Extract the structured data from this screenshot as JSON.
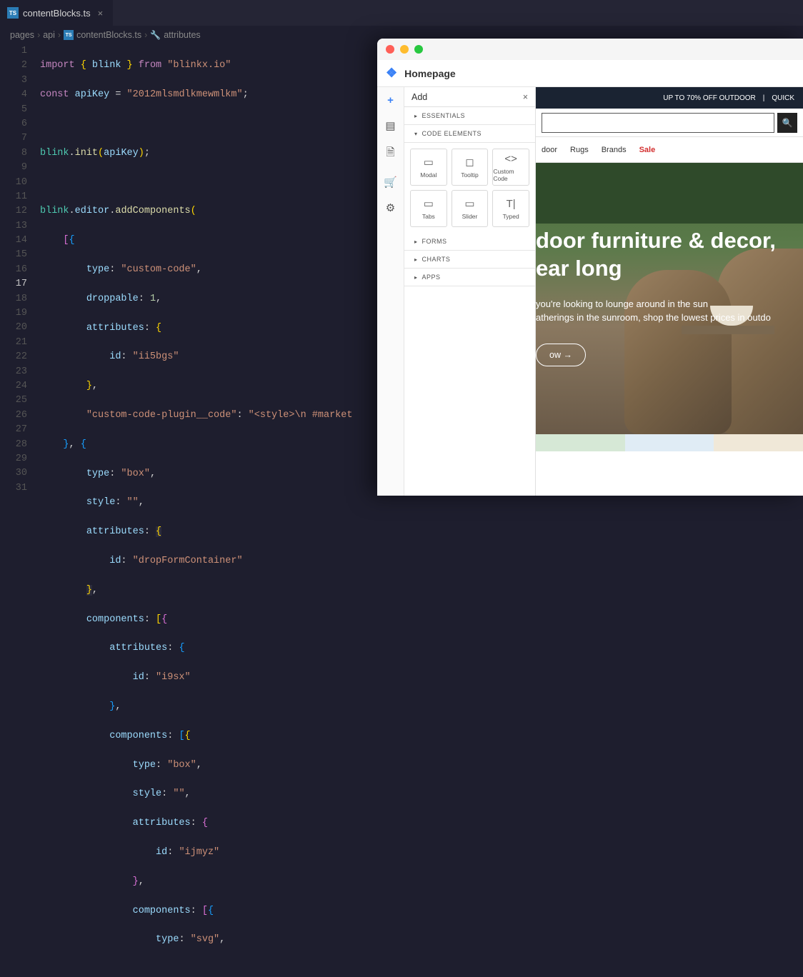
{
  "tab": {
    "filename": "contentBlocks.ts"
  },
  "breadcrumbs": {
    "seg1": "pages",
    "seg2": "api",
    "seg3": "contentBlocks.ts",
    "seg4": "attributes"
  },
  "code": {
    "l1_import": "import",
    "l1_brace_o": " { ",
    "l1_blink": "blink",
    "l1_brace_c": " } ",
    "l1_from": "from",
    "l1_str": " \"blinkx.io\"",
    "l2_const": "const",
    "l2_var": " apiKey",
    "l2_eq": " = ",
    "l2_str": "\"2012mlsmdlkmewmlkm\"",
    "l2_semi": ";",
    "l4_blink": "blink",
    "l4_dot1": ".",
    "l4_init": "init",
    "l4_p": "(apiKey);",
    "l6_blink": "blink",
    "l6_editor": ".editor.",
    "l6_add": "addComponents",
    "l6_open": "(",
    "l7": "    [{",
    "l8_type": "type",
    "l8_val": "\"custom-code\"",
    "l9_drop": "droppable",
    "l9_val": "1",
    "l10_attr": "attributes",
    "l11_id": "id",
    "l11_val": "\"ii5bgs\"",
    "l13_key": "\"custom-code-plugin__code\"",
    "l13_val": "\"<style>\\n #market",
    "l15_type": "type",
    "l15_val": "\"box\"",
    "l16_style": "style",
    "l16_val": "\"\"",
    "l17_attr": "attributes",
    "l18_id": "id",
    "l18_val": "\"dropFormContainer\"",
    "l20_comp": "components",
    "l21_attr": "attributes",
    "l22_id": "id",
    "l22_val": "\"i9sx\"",
    "l24_comp": "components",
    "l25_type": "type",
    "l25_val": "\"box\"",
    "l26_style": "style",
    "l26_val": "\"\"",
    "l27_attr": "attributes",
    "l28_id": "id",
    "l28_val": "\"ijmyz\"",
    "l30_comp": "components",
    "l31_type": "type",
    "l31_val": "\"svg\""
  },
  "line_numbers": [
    "1",
    "2",
    "3",
    "4",
    "5",
    "6",
    "7",
    "8",
    "9",
    "10",
    "11",
    "12",
    "13",
    "14",
    "15",
    "16",
    "17",
    "18",
    "19",
    "20",
    "21",
    "22",
    "23",
    "24",
    "25",
    "26",
    "27",
    "28",
    "29",
    "30",
    "31"
  ],
  "active_line": "17",
  "app": {
    "title": "Homepage",
    "add_label": "Add",
    "accordion": {
      "essentials": "ESSENTIALS",
      "code_elements": "CODE ELEMENTS",
      "forms": "FORMS",
      "charts": "CHARTS",
      "apps": "APPS"
    },
    "components": {
      "modal": "Modal",
      "tooltip": "Tooltip",
      "custom_code": "Custom Code",
      "tabs": "Tabs",
      "slider": "Slider",
      "typed": "Typed"
    },
    "promo": {
      "text": "UP TO 70% OFF OUTDOOR",
      "sep": "|",
      "quick": "QUICK"
    },
    "nav": {
      "cat1": "door",
      "cat2": "Rugs",
      "cat3": "Brands",
      "cat4": "Sale"
    },
    "hero": {
      "title1": "door furniture & decor,",
      "title2": "ear long",
      "sub1": "you're looking to lounge around in the sun",
      "sub2": "atherings in the sunroom, shop the lowest prices in outdo",
      "btn": "ow →"
    }
  }
}
